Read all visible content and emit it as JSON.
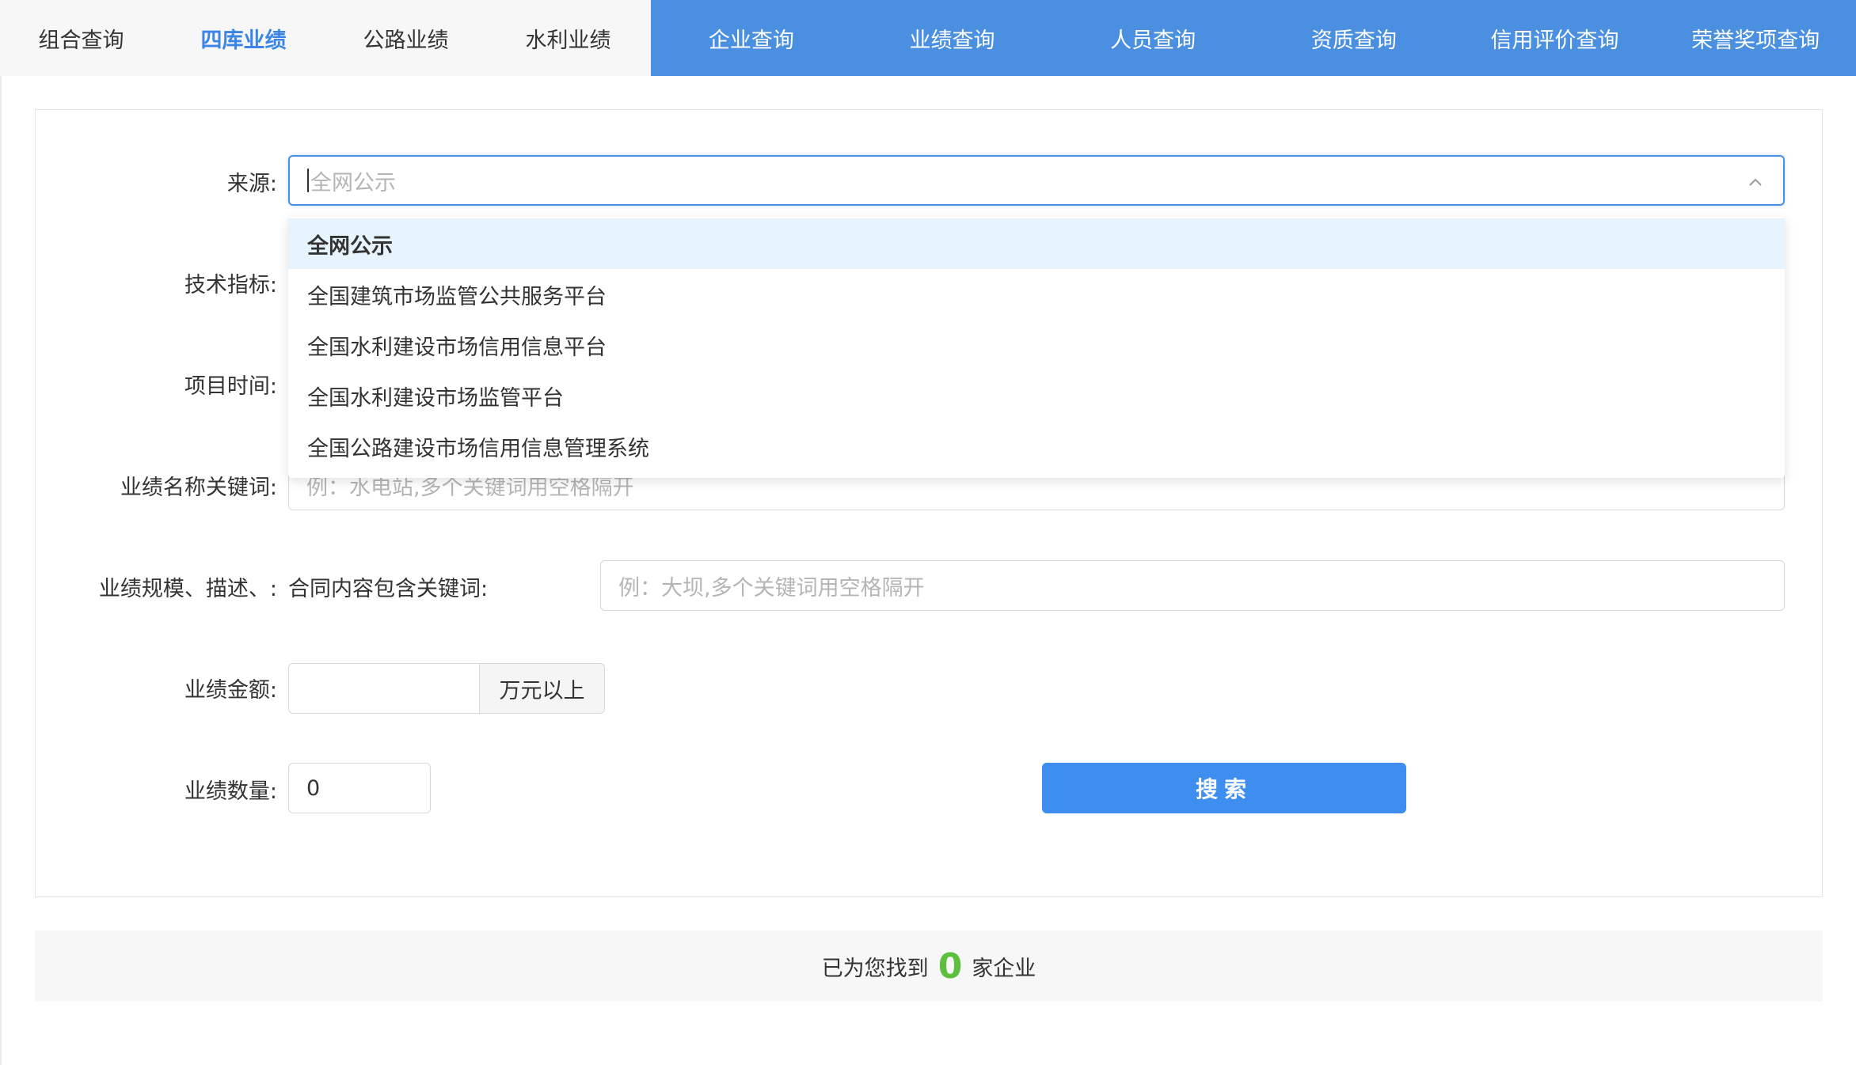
{
  "tabs_left": [
    {
      "label": "组合查询",
      "active": false
    },
    {
      "label": "四库业绩",
      "active": true
    },
    {
      "label": "公路业绩",
      "active": false
    },
    {
      "label": "水利业绩",
      "active": false
    }
  ],
  "tabs_right": [
    {
      "label": "企业查询"
    },
    {
      "label": "业绩查询"
    },
    {
      "label": "人员查询"
    },
    {
      "label": "资质查询"
    },
    {
      "label": "信用评价查询"
    },
    {
      "label": "荣誉奖项查询"
    }
  ],
  "form": {
    "source": {
      "label": "来源:",
      "placeholder": "全网公示",
      "options": [
        "全网公示",
        "全国建筑市场监管公共服务平台",
        "全国水利建设市场信用信息平台",
        "全国水利建设市场监管平台",
        "全国公路建设市场信用信息管理系统"
      ],
      "selected_index": 0
    },
    "tech_label": "技术指标:",
    "time_label": "项目时间:",
    "keyword": {
      "label": "业绩名称关键词:",
      "placeholder": "例：水电站,多个关键词用空格隔开"
    },
    "scale": {
      "label": "业绩规模、描述、:",
      "sublabel": "合同内容包含关键词:",
      "placeholder": "例：大坝,多个关键词用空格隔开"
    },
    "amount": {
      "label": "业绩金额:",
      "value": "",
      "unit": "万元以上"
    },
    "count": {
      "label": "业绩数量:",
      "value": "0"
    },
    "search_label": "搜索"
  },
  "result": {
    "prefix": "已为您找到",
    "count": "0",
    "suffix": "家企业"
  },
  "colors": {
    "accent": "#4a8fe0",
    "button": "#3e8ef0",
    "count": "#5cbf3f",
    "selected_option_bg": "#e8f4fd"
  }
}
